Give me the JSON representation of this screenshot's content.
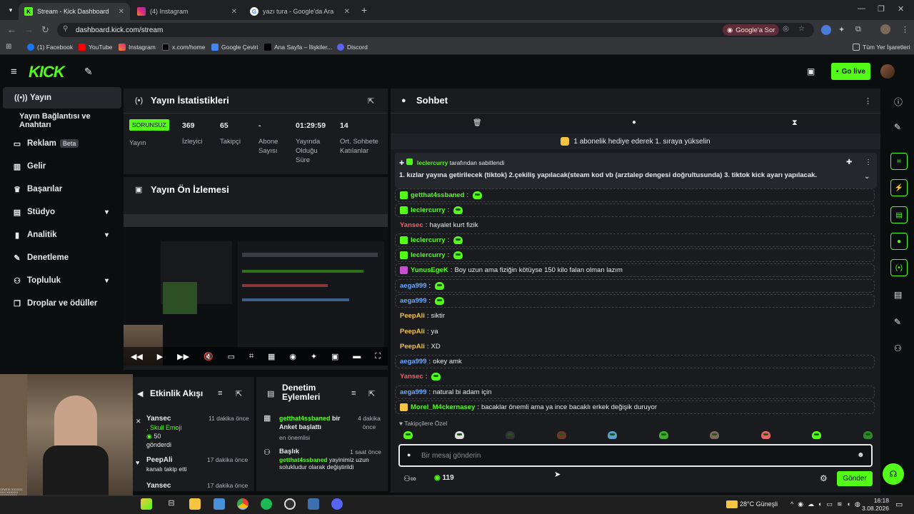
{
  "browser": {
    "tabs": [
      {
        "title": "Stream - Kick Dashboard",
        "active": true
      },
      {
        "title": "(4) Instagram",
        "active": false
      },
      {
        "title": "yazı tura - Google'da Ara",
        "active": false
      }
    ],
    "url": "dashboard.kick.com/stream",
    "google_btn": "Google'a Sor",
    "bookmarks": [
      "(1) Facebook",
      "YouTube",
      "Instagram",
      "x.com/home",
      "Google Çeviri",
      "Ana Sayfa – İlişkiler...",
      "Discord"
    ],
    "all_bookmarks": "Tüm Yer İşaretleri"
  },
  "kick": {
    "logo": "KICK",
    "go_live": "Go live"
  },
  "sidebar": {
    "items": [
      {
        "label": "Yayın",
        "icon": "broadcast-icon"
      },
      {
        "label": "Yayın Bağlantısı ve Anahtarı",
        "icon": ""
      },
      {
        "label": "Reklam",
        "icon": "ad-icon",
        "badge": "Beta"
      },
      {
        "label": "Gelir",
        "icon": "revenue-icon"
      },
      {
        "label": "Başarılar",
        "icon": "trophy-icon"
      },
      {
        "label": "Stüdyo",
        "icon": "studio-icon"
      },
      {
        "label": "Analitik",
        "icon": "analytics-icon"
      },
      {
        "label": "Denetleme",
        "icon": "wrench-icon"
      },
      {
        "label": "Topluluk",
        "icon": "community-icon"
      },
      {
        "label": "Droplar ve ödüller",
        "icon": "gift-icon"
      }
    ]
  },
  "stats": {
    "title": "Yayın İstatistikleri",
    "status": "SORUNSUZ",
    "status_label": "Yayın",
    "viewers": "369",
    "viewers_label": "İzleyici",
    "followers": "65",
    "followers_label": "Takipçi",
    "subs": "-",
    "subs_label": "Abone Sayısı",
    "duration": "01:29:59",
    "duration_label": "Yayında Olduğu Süre",
    "avg": "14",
    "avg_label": "Ort. Sohbete Katılanlar"
  },
  "preview": {
    "title": "Yayın Ön İzlemesi"
  },
  "events": {
    "title": "Etkinlik Akışı",
    "items": [
      {
        "user": "Yansec",
        "time": "11 dakika önce",
        "line1": "Skull Emoji",
        "line2": "50",
        "line3": "gönderdi"
      },
      {
        "user": "PeepAli",
        "time": "17 dakika önce",
        "line1": "kanalı takip etti"
      },
      {
        "user": "Yansec",
        "time": "17 dakika önce"
      }
    ]
  },
  "modactions": {
    "title": "Denetim Eylemleri",
    "items": [
      {
        "user": "getthat4ssbaned",
        "text": "bir Anket başlattı",
        "sub": "en önemlisi",
        "time": "4 dakika önce"
      },
      {
        "title": "Başlık",
        "user": "getthat4ssbaned",
        "text": "yayinimiz uzun solukludur olarak değiştirildi",
        "time": "1 saat önce"
      }
    ]
  },
  "chat": {
    "title": "Sohbet",
    "banner": "1 abonelik hediye ederek 1. sıraya yükselin",
    "pinned_by": "leclercurry",
    "pinned_suffix": "tarafından sabitlendi",
    "pinned_text": "1. kızlar yayına getirilecek (tiktok) 2.çekiliş yapılacak(steam kod vb (arztalep dengesi doğrultusunda) 3. tiktok kick ayarı yapılacak.",
    "messages": [
      {
        "user": "getthat4ssbaned",
        "text": "",
        "color": "#53fc18",
        "emote": true
      },
      {
        "user": "leclercurry",
        "text": "",
        "color": "#53fc18",
        "emote": true
      },
      {
        "user": "Yansec",
        "text": "hayalet kurt fizik",
        "color": "#ff5a5f",
        "emote": false
      },
      {
        "user": "leclercurry",
        "text": "",
        "color": "#53fc18",
        "emote": true
      },
      {
        "user": "leclercurry",
        "text": "",
        "color": "#53fc18",
        "emote": true
      },
      {
        "user": "YunusEgeK",
        "text": "Boy uzun ama fiziğin kötüyse 150 kilo falan olman lazım",
        "color": "#53fc18",
        "emote": false
      },
      {
        "user": "aega999",
        "text": "",
        "color": "#6aa9ff",
        "emote": true
      },
      {
        "user": "aega999",
        "text": "",
        "color": "#6aa9ff",
        "emote": true
      },
      {
        "user": "PeepAli",
        "text": "siktir",
        "color": "#f5c542",
        "emote": false
      },
      {
        "user": "PeepAli",
        "text": "ya",
        "color": "#f5c542",
        "emote": false
      },
      {
        "user": "PeepAli",
        "text": "XD",
        "color": "#f5c542",
        "emote": false
      },
      {
        "user": "aega999",
        "text": "okey amk",
        "color": "#6aa9ff",
        "emote": false
      },
      {
        "user": "Yansec",
        "text": "",
        "color": "#ff5a5f",
        "emote": true
      },
      {
        "user": "aega999",
        "text": "natural bi adam için",
        "color": "#6aa9ff",
        "emote": false
      },
      {
        "user": "Morel_M4ckernasey",
        "text": "bacaklar önemli ama ya ince bacaklı erkek değişik duruyor",
        "color": "#53fc18",
        "emote": false
      }
    ],
    "followers_special": "Takipçilere Özel",
    "placeholder": "Bir mesaj gönderin",
    "points": "119",
    "send": "Gönder"
  },
  "taskbar": {
    "weather": "28°C Güneşli",
    "time": "16:18",
    "date": "3.08.2026"
  },
  "webcam_overlay": "GRATIS XXXXXX XXX\nXXXXXX XXXXXXXXX"
}
